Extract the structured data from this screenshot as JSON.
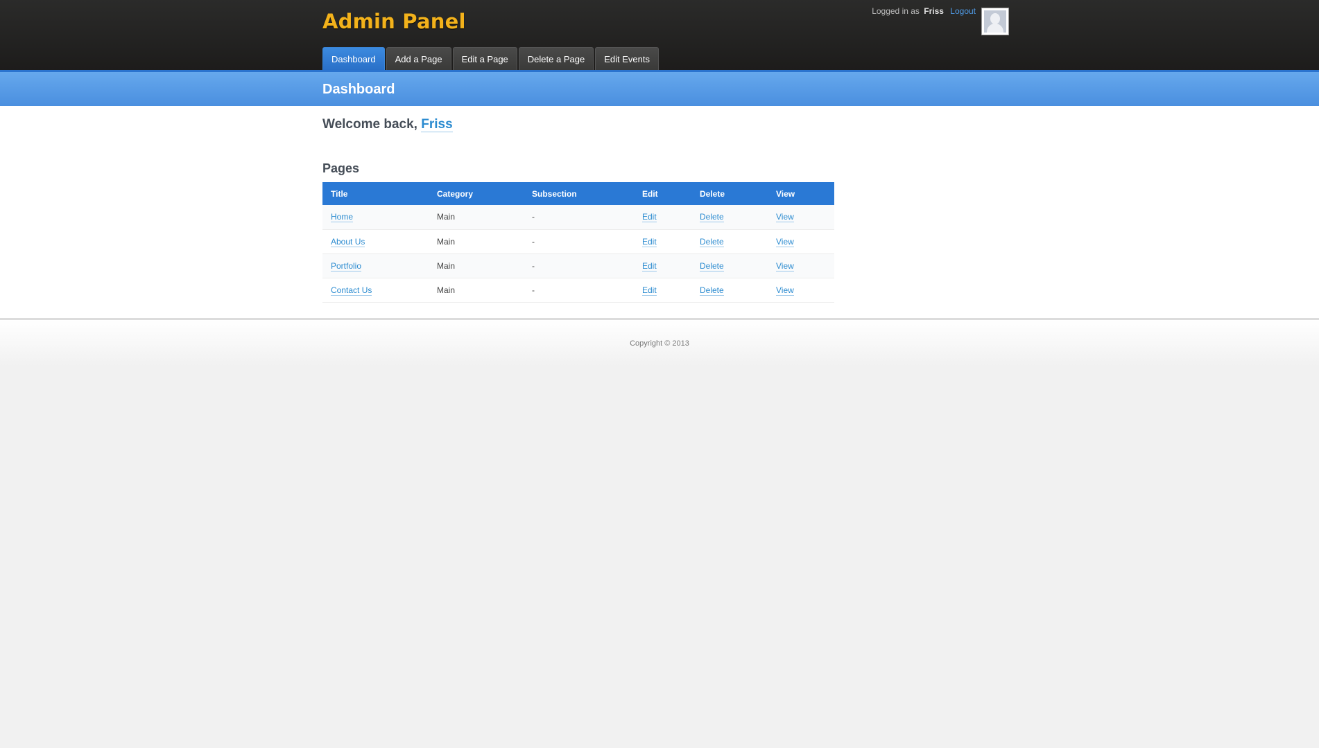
{
  "header": {
    "app_title": "Admin Panel",
    "logged_in_prefix": "Logged in as",
    "username": "Friss",
    "logout_label": "Logout",
    "accent_color": "#f3b21b"
  },
  "tabs": [
    {
      "label": "Dashboard",
      "active": true
    },
    {
      "label": "Add a Page",
      "active": false
    },
    {
      "label": "Edit a Page",
      "active": false
    },
    {
      "label": "Delete a Page",
      "active": false
    },
    {
      "label": "Edit Events",
      "active": false
    }
  ],
  "section": {
    "title": "Dashboard"
  },
  "main": {
    "welcome_prefix": "Welcome back,",
    "welcome_name": "Friss",
    "pages_heading": "Pages",
    "table": {
      "columns": [
        "Title",
        "Category",
        "Subsection",
        "Edit",
        "Delete",
        "View"
      ],
      "rows": [
        {
          "title": "Home",
          "category": "Main",
          "subsection": "-",
          "edit": "Edit",
          "delete": "Delete",
          "view": "View"
        },
        {
          "title": "About Us",
          "category": "Main",
          "subsection": "-",
          "edit": "Edit",
          "delete": "Delete",
          "view": "View"
        },
        {
          "title": "Portfolio",
          "category": "Main",
          "subsection": "-",
          "edit": "Edit",
          "delete": "Delete",
          "view": "View"
        },
        {
          "title": "Contact Us",
          "category": "Main",
          "subsection": "-",
          "edit": "Edit",
          "delete": "Delete",
          "view": "View"
        }
      ]
    }
  },
  "footer": {
    "copyright": "Copyright © 2013"
  },
  "colors": {
    "header_bg": "#1d1c1b",
    "primary_blue": "#2a79d5",
    "link_blue": "#2b8bd0"
  }
}
